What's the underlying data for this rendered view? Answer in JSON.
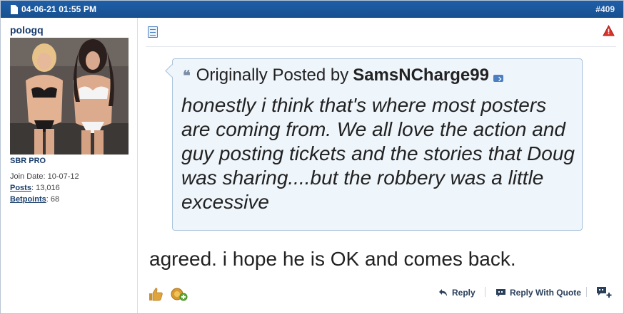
{
  "header": {
    "date": "04-06-21 01:55 PM",
    "post_number": "#409"
  },
  "user": {
    "username": "pologq",
    "title": "SBR PRO",
    "join_date_label": "Join Date:",
    "join_date": "10-07-12",
    "posts_label": "Posts",
    "posts": "13,016",
    "betpoints_label": "Betpoints",
    "betpoints": "68"
  },
  "quote": {
    "prefix": "Originally Posted by",
    "author": "SamsNCharge99",
    "text": "honestly i think that's where most posters are coming from. We all love the action and guy posting tickets and the stories that Doug was sharing....but the robbery was a little excessive"
  },
  "message": "agreed. i hope he is OK and comes back.",
  "actions": {
    "reply": "Reply",
    "reply_with_quote": "Reply With Quote"
  },
  "colors": {
    "header_bg": "#1f5fa8",
    "quote_bg": "#eef5fb",
    "quote_border": "#a9c3dc",
    "link": "#1a3e6b"
  },
  "icons": [
    "document-icon",
    "post-icon",
    "warning-icon",
    "quote-icon",
    "view-post-icon",
    "like-icon",
    "thanks-icon",
    "reply-icon",
    "reply-with-quote-icon",
    "multi-quote-icon"
  ]
}
